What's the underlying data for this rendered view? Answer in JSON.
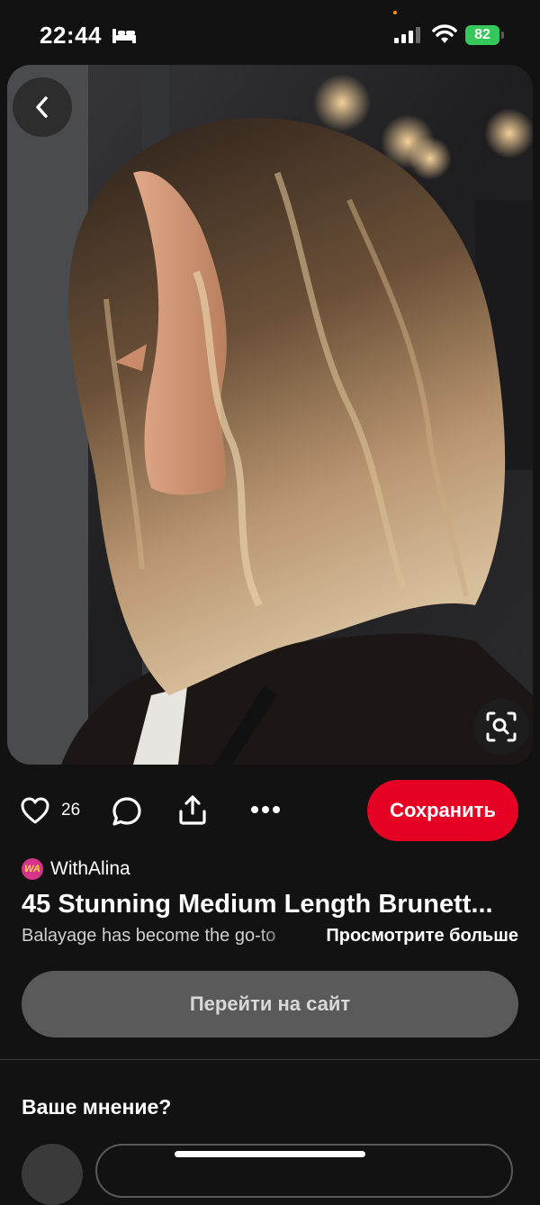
{
  "status_bar": {
    "time": "22:44",
    "battery": "82"
  },
  "icons": {
    "bed": "bed-icon",
    "signal": "cellular-signal-icon",
    "wifi": "wifi-icon",
    "back": "chevron-left-icon",
    "visual_search": "visual-search-icon",
    "like": "heart-icon",
    "comment": "speech-bubble-icon",
    "share": "share-icon",
    "more": "more-dots-icon"
  },
  "actions": {
    "like_count": "26",
    "save_label": "Сохранить"
  },
  "pin": {
    "author_avatar": "WA",
    "author_name": "WithAlina",
    "title": "45 Stunning Medium Length Brunett...",
    "description": "Balayage has become the go-to",
    "see_more": "Просмотрите больше"
  },
  "visit_label": "Перейти на сайт",
  "feedback": {
    "heading": "Ваше мнение?"
  },
  "colors": {
    "accent": "#e60023",
    "battery": "#34c759",
    "background": "#121212"
  }
}
